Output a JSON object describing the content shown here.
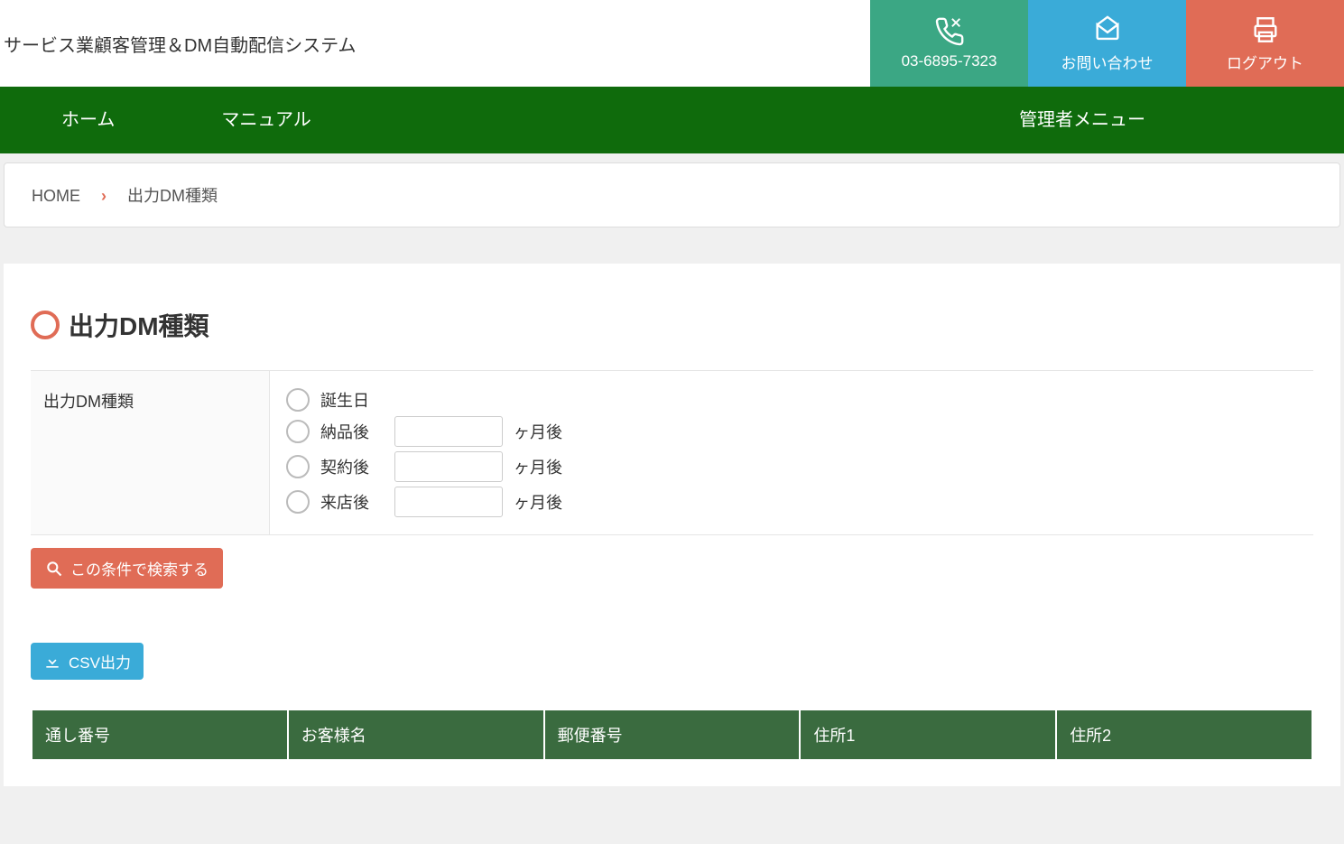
{
  "header": {
    "title": "サービス業顧客管理＆DM自動配信システム",
    "phone": "03-6895-7323",
    "contact": "お問い合わせ",
    "logout": "ログアウト"
  },
  "nav": {
    "home": "ホーム",
    "manual": "マニュアル",
    "admin": "管理者メニュー"
  },
  "breadcrumb": {
    "home": "HOME",
    "current": "出力DM種類"
  },
  "page": {
    "title": "出力DM種類",
    "form_label": "出力DM種類",
    "radios": {
      "birthday": "誕生日",
      "after_delivery": "納品後",
      "after_contract": "契約後",
      "after_visit": "来店後"
    },
    "months_suffix": "ヶ月後",
    "search_button": "この条件で検索する",
    "csv_button": "CSV出力",
    "table_headers": [
      "通し番号",
      "お客様名",
      "郵便番号",
      "住所1",
      "住所2"
    ]
  }
}
